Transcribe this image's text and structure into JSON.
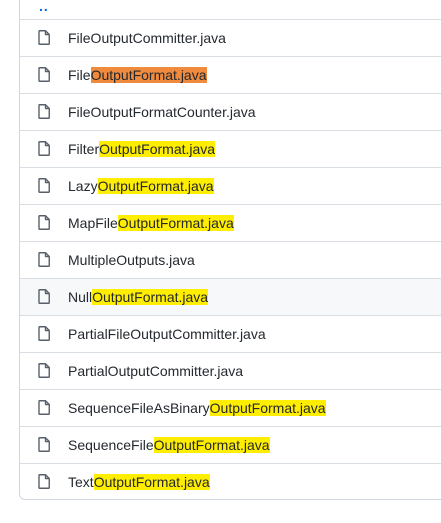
{
  "parent_link": "..",
  "files": [
    {
      "before": "FileOutputCommitter.java",
      "match": "",
      "after": ""
    },
    {
      "before": "File",
      "match": "OutputFormat.java",
      "after": "",
      "active": true
    },
    {
      "before": "FileOutputFormatCounter.java",
      "match": "",
      "after": ""
    },
    {
      "before": "Filter",
      "match": "OutputFormat.java",
      "after": ""
    },
    {
      "before": "Lazy",
      "match": "OutputFormat.java",
      "after": ""
    },
    {
      "before": "MapFile",
      "match": "OutputFormat.java",
      "after": ""
    },
    {
      "before": "MultipleOutputs.java",
      "match": "",
      "after": ""
    },
    {
      "before": "Null",
      "match": "OutputFormat.java",
      "after": "",
      "hovered": true
    },
    {
      "before": "PartialFileOutputCommitter.java",
      "match": "",
      "after": ""
    },
    {
      "before": "PartialOutputCommitter.java",
      "match": "",
      "after": ""
    },
    {
      "before": "SequenceFileAsBinary",
      "match": "OutputFormat.java",
      "after": ""
    },
    {
      "before": "SequenceFile",
      "match": "OutputFormat.java",
      "after": ""
    },
    {
      "before": "Text",
      "match": "OutputFormat.java",
      "after": ""
    }
  ],
  "icon": "file-icon",
  "colors": {
    "highlight": "#ffee00",
    "highlight_active": "#f08a3c",
    "link": "#0969da",
    "border": "#d0d7de"
  }
}
